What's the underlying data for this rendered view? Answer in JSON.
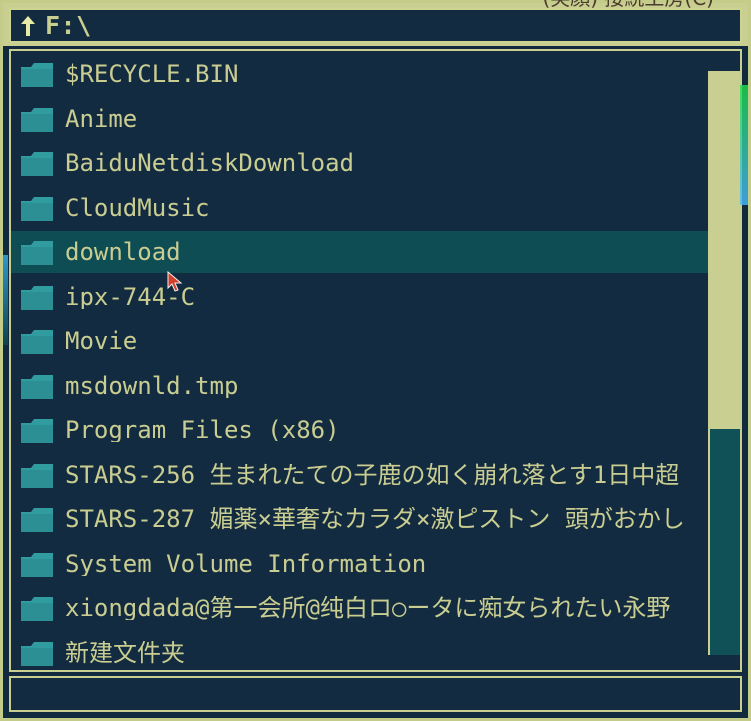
{
  "window": {
    "background": "#112a3e",
    "accent": "#c8cf90",
    "selection": "#0f4d55"
  },
  "top_bleed_text": "(笑顔) 接続工房(C)",
  "address_bar": {
    "path": "F:\\",
    "up_icon": "up-arrow-icon"
  },
  "files": [
    {
      "name": "$RECYCLE.BIN",
      "icon": "folder-icon"
    },
    {
      "name": "Anime",
      "icon": "folder-icon"
    },
    {
      "name": "BaiduNetdiskDownload",
      "icon": "folder-icon"
    },
    {
      "name": "CloudMusic",
      "icon": "folder-icon"
    },
    {
      "name": "download",
      "icon": "folder-icon",
      "selected": true
    },
    {
      "name": "ipx-744-C",
      "icon": "folder-icon"
    },
    {
      "name": "Movie",
      "icon": "folder-icon"
    },
    {
      "name": "msdownld.tmp",
      "icon": "folder-icon"
    },
    {
      "name": "Program Files (x86)",
      "icon": "folder-icon"
    },
    {
      "name": "STARS-256 生まれたての子鹿の如く崩れ落とす1日中超",
      "icon": "folder-icon"
    },
    {
      "name": "STARS-287 媚薬×華奢なカラダ×激ピストン 頭がおかし",
      "icon": "folder-icon"
    },
    {
      "name": "System Volume Information",
      "icon": "folder-icon"
    },
    {
      "name": "xiongdada@第一会所@纯白ロ○ータに痴女られたい永野",
      "icon": "folder-icon"
    },
    {
      "name": "新建文件夹",
      "icon": "folder-icon"
    }
  ],
  "scrollbar": {
    "thumb_fraction_visible": 0.61,
    "position": "top"
  },
  "bottom_bar": {
    "text": ""
  }
}
